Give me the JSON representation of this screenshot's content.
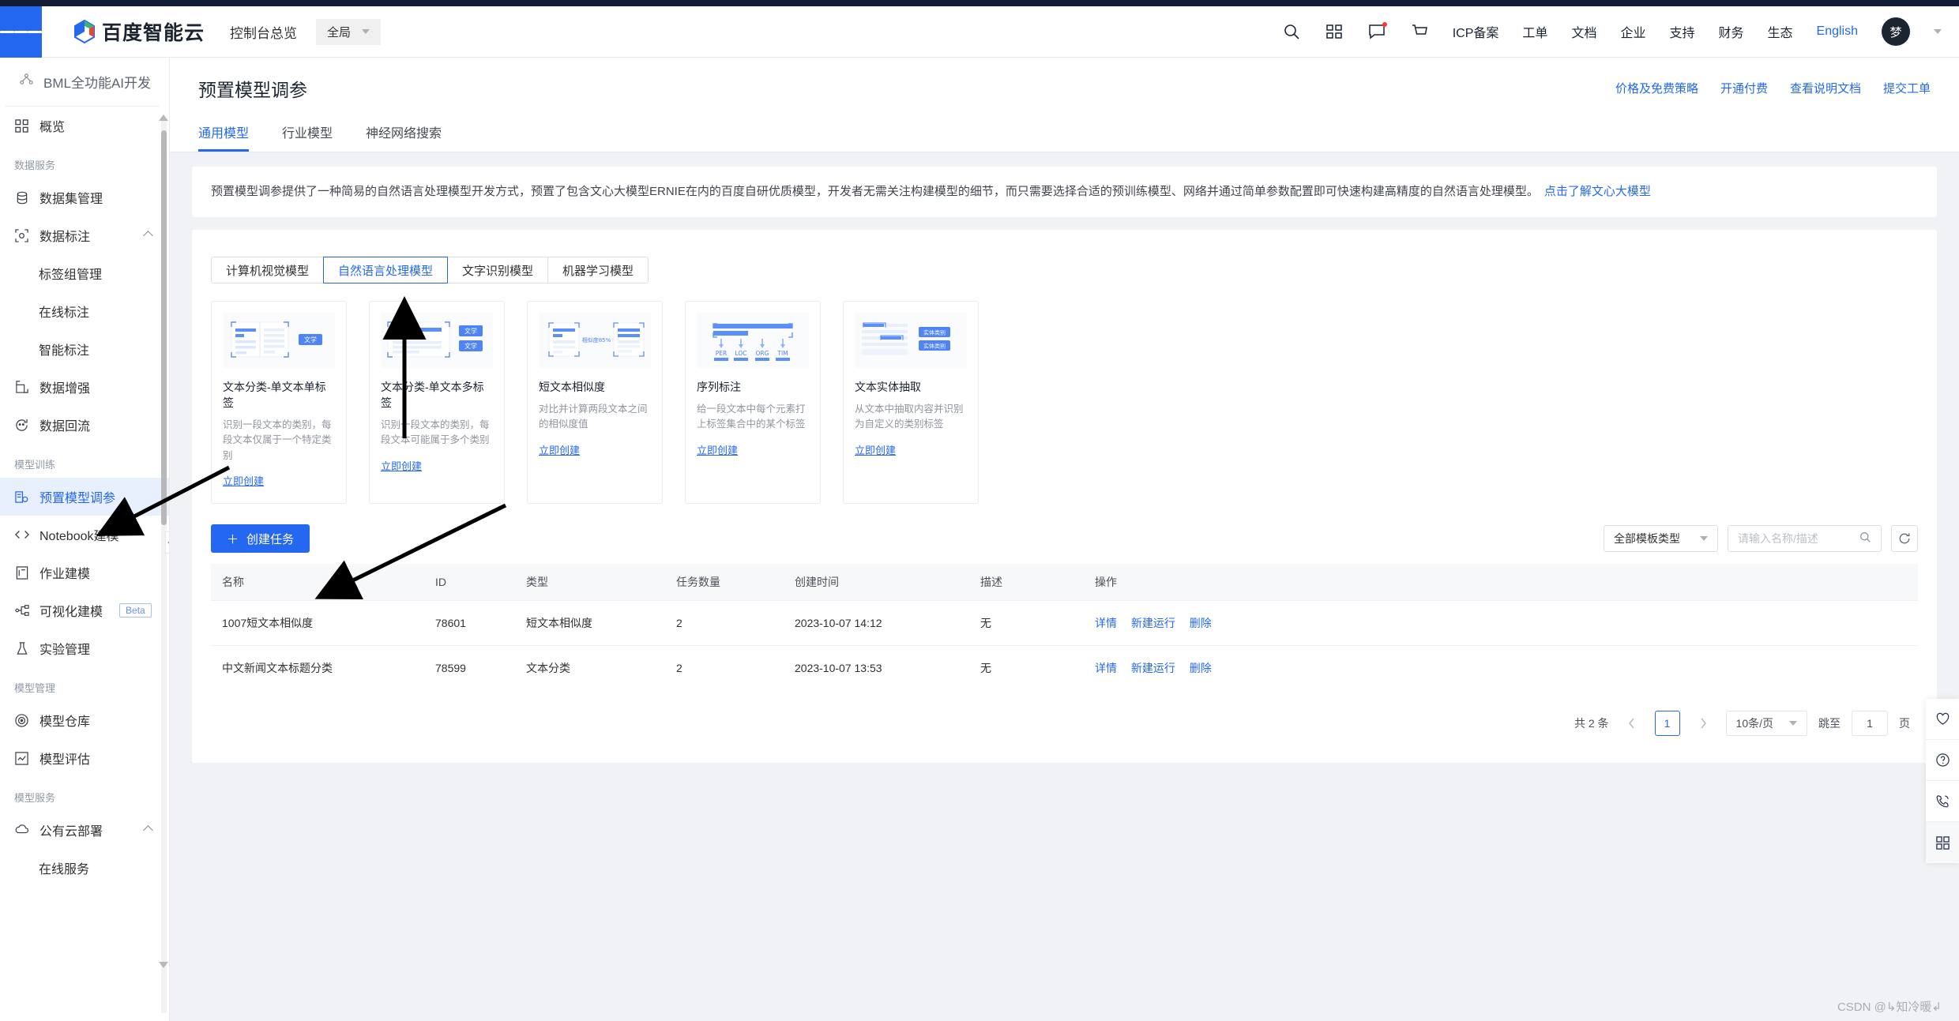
{
  "header": {
    "brand": "百度智能云",
    "console_title": "控制台总览",
    "region": "全局",
    "icons": [
      "search-icon",
      "apps-icon",
      "message-icon",
      "cart-icon"
    ],
    "links": [
      "ICP备案",
      "工单",
      "文档",
      "企业",
      "支持",
      "财务",
      "生态"
    ],
    "language": "English",
    "avatar": "梦"
  },
  "sidebar": {
    "product": "BML全功能AI开发",
    "groups": [
      {
        "label": "",
        "items": [
          {
            "label": "概览",
            "icon": "grid-icon"
          }
        ]
      },
      {
        "label": "数据服务",
        "items": [
          {
            "label": "数据集管理",
            "icon": "database-icon"
          },
          {
            "label": "数据标注",
            "icon": "annotate-icon",
            "expandable": true
          },
          {
            "label": "标签组管理",
            "sub": true
          },
          {
            "label": "在线标注",
            "sub": true
          },
          {
            "label": "智能标注",
            "sub": true
          },
          {
            "label": "数据增强",
            "icon": "expand-icon"
          },
          {
            "label": "数据回流",
            "icon": "refresh-circle-icon"
          }
        ]
      },
      {
        "label": "模型训练",
        "items": [
          {
            "label": "预置模型调参",
            "icon": "tune-icon",
            "active": true
          },
          {
            "label": "Notebook建模",
            "icon": "code-icon"
          },
          {
            "label": "作业建模",
            "icon": "job-icon"
          },
          {
            "label": "可视化建模",
            "icon": "graph-icon",
            "badge": "Beta"
          },
          {
            "label": "实验管理",
            "icon": "flask-icon"
          }
        ]
      },
      {
        "label": "模型管理",
        "items": [
          {
            "label": "模型仓库",
            "icon": "target-icon"
          },
          {
            "label": "模型评估",
            "icon": "chart-edit-icon"
          }
        ]
      },
      {
        "label": "模型服务",
        "items": [
          {
            "label": "公有云部署",
            "icon": "cloud-icon",
            "expandable": true
          },
          {
            "label": "在线服务",
            "sub": true
          }
        ]
      }
    ]
  },
  "page": {
    "title": "预置模型调参",
    "head_links": [
      "价格及免费策略",
      "开通付费",
      "查看说明文档",
      "提交工单"
    ],
    "tabs": [
      {
        "label": "通用模型",
        "active": true
      },
      {
        "label": "行业模型",
        "active": false
      },
      {
        "label": "神经网络搜索",
        "active": false
      }
    ],
    "notice": "预置模型调参提供了一种简易的自然语言处理模型开发方式，预置了包含文心大模型ERNIE在内的百度自研优质模型，开发者无需关注构建模型的细节，而只需要选择合适的预训练模型、网络并通过简单参数配置即可快速构建高精度的自然语言处理模型。",
    "notice_link": "点击了解文心大模型"
  },
  "model_categories": [
    {
      "label": "计算机视觉模型",
      "active": false
    },
    {
      "label": "自然语言处理模型",
      "active": true
    },
    {
      "label": "文字识别模型",
      "active": false
    },
    {
      "label": "机器学习模型",
      "active": false
    }
  ],
  "cards": [
    {
      "title": "文本分类-单文本单标签",
      "desc": "识别一段文本的类别，每段文本仅属于一个特定类别",
      "link": "立即创建",
      "thumb": "two-column-doc-with-tag",
      "tag": "文学"
    },
    {
      "title": "文本分类-单文本多标签",
      "desc": "识别一段文本的类别，每段文本可能属于多个类别",
      "link": "立即创建",
      "thumb": "doc-with-two-tags",
      "tag": "文学"
    },
    {
      "title": "短文本相似度",
      "desc": "对比并计算两段文本之间的相似度值",
      "link": "立即创建",
      "thumb": "two-docs-similarity",
      "tag": "相似度85%"
    },
    {
      "title": "序列标注",
      "desc": "给一段文本中每个元素打上标签集合中的某个标签",
      "link": "立即创建",
      "thumb": "sequence-labels",
      "labels": [
        "PER",
        "LOC",
        "ORG",
        "TIM"
      ]
    },
    {
      "title": "文本实体抽取",
      "desc": "从文本中抽取内容并识别为自定义的类别标签",
      "link": "立即创建",
      "thumb": "entity-extraction",
      "tag": "实体类别"
    }
  ],
  "toolbar": {
    "create_button": "创建任务",
    "create_icon": "plus-icon",
    "filter_value": "全部模板类型",
    "search_placeholder": "请输入名称/描述",
    "search_icon": "search-icon",
    "refresh_icon": "refresh-icon"
  },
  "table": {
    "columns": [
      "名称",
      "ID",
      "类型",
      "任务数量",
      "创建时间",
      "描述",
      "操作"
    ],
    "rows": [
      {
        "name": "1007短文本相似度",
        "id": "78601",
        "type": "短文本相似度",
        "count": "2",
        "created": "2023-10-07 14:12",
        "desc": "无",
        "actions": [
          "详情",
          "新建运行",
          "删除"
        ]
      },
      {
        "name": "中文新闻文本标题分类",
        "id": "78599",
        "type": "文本分类",
        "count": "2",
        "created": "2023-10-07 13:53",
        "desc": "无",
        "actions": [
          "详情",
          "新建运行",
          "删除"
        ]
      }
    ]
  },
  "pagination": {
    "total": "共 2 条",
    "prev_icon": "chevron-left-icon",
    "current": "1",
    "next_icon": "chevron-right-icon",
    "page_size": "10条/页",
    "jump_label": "跳至",
    "jump_value": "1",
    "page_unit": "页"
  },
  "rail": [
    "heart-icon",
    "question-icon",
    "phone-icon",
    "grid-icon"
  ],
  "watermark": "CSDN @↳知冷暖↲"
}
